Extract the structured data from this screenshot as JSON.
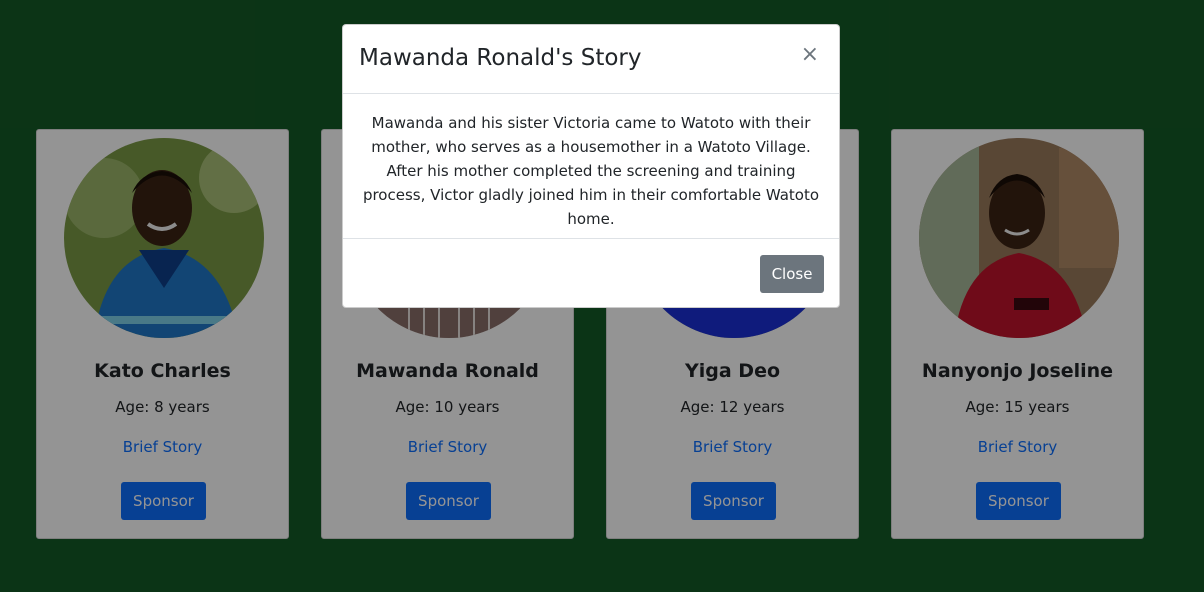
{
  "colors": {
    "page_background": "#145a26",
    "link": "#0d6efd",
    "primary_button": "#0d6efd",
    "secondary_button": "#6c757d"
  },
  "children": [
    {
      "name": "Kato Charles",
      "age": "Age: 8 years",
      "story_link": "Brief Story",
      "sponsor_label": "Sponsor",
      "shirt_color": "#1f78c8",
      "skin_color": "#3b2314",
      "bg_color": "#6f8f3a"
    },
    {
      "name": "Mawanda Ronald",
      "age": "Age: 10 years",
      "story_link": "Brief Story",
      "sponsor_label": "Sponsor",
      "shirt_color": "#8a6e6a",
      "skin_color": "#3b2314",
      "bg_color": "#b9b3a9"
    },
    {
      "name": "Yiga Deo",
      "age": "Age: 12 years",
      "story_link": "Brief Story",
      "sponsor_label": "Sponsor",
      "shirt_color": "#1a2fd6",
      "skin_color": "#3b2314",
      "bg_color": "#9aa37a"
    },
    {
      "name": "Nanyonjo Joseline",
      "age": "Age: 15 years",
      "story_link": "Brief Story",
      "sponsor_label": "Sponsor",
      "shirt_color": "#c0142c",
      "skin_color": "#3b2314",
      "bg_color": "#8d6a4d"
    }
  ],
  "modal": {
    "title": "Mawanda Ronald's Story",
    "close_symbol": "×",
    "body": "Mawanda and his sister Victoria came to Watoto with their mother, who serves as a housemother in a Watoto Village. After his mother completed the screening and training process, Victor gladly joined him in their comfortable Watoto home.",
    "close_button_label": "Close"
  }
}
